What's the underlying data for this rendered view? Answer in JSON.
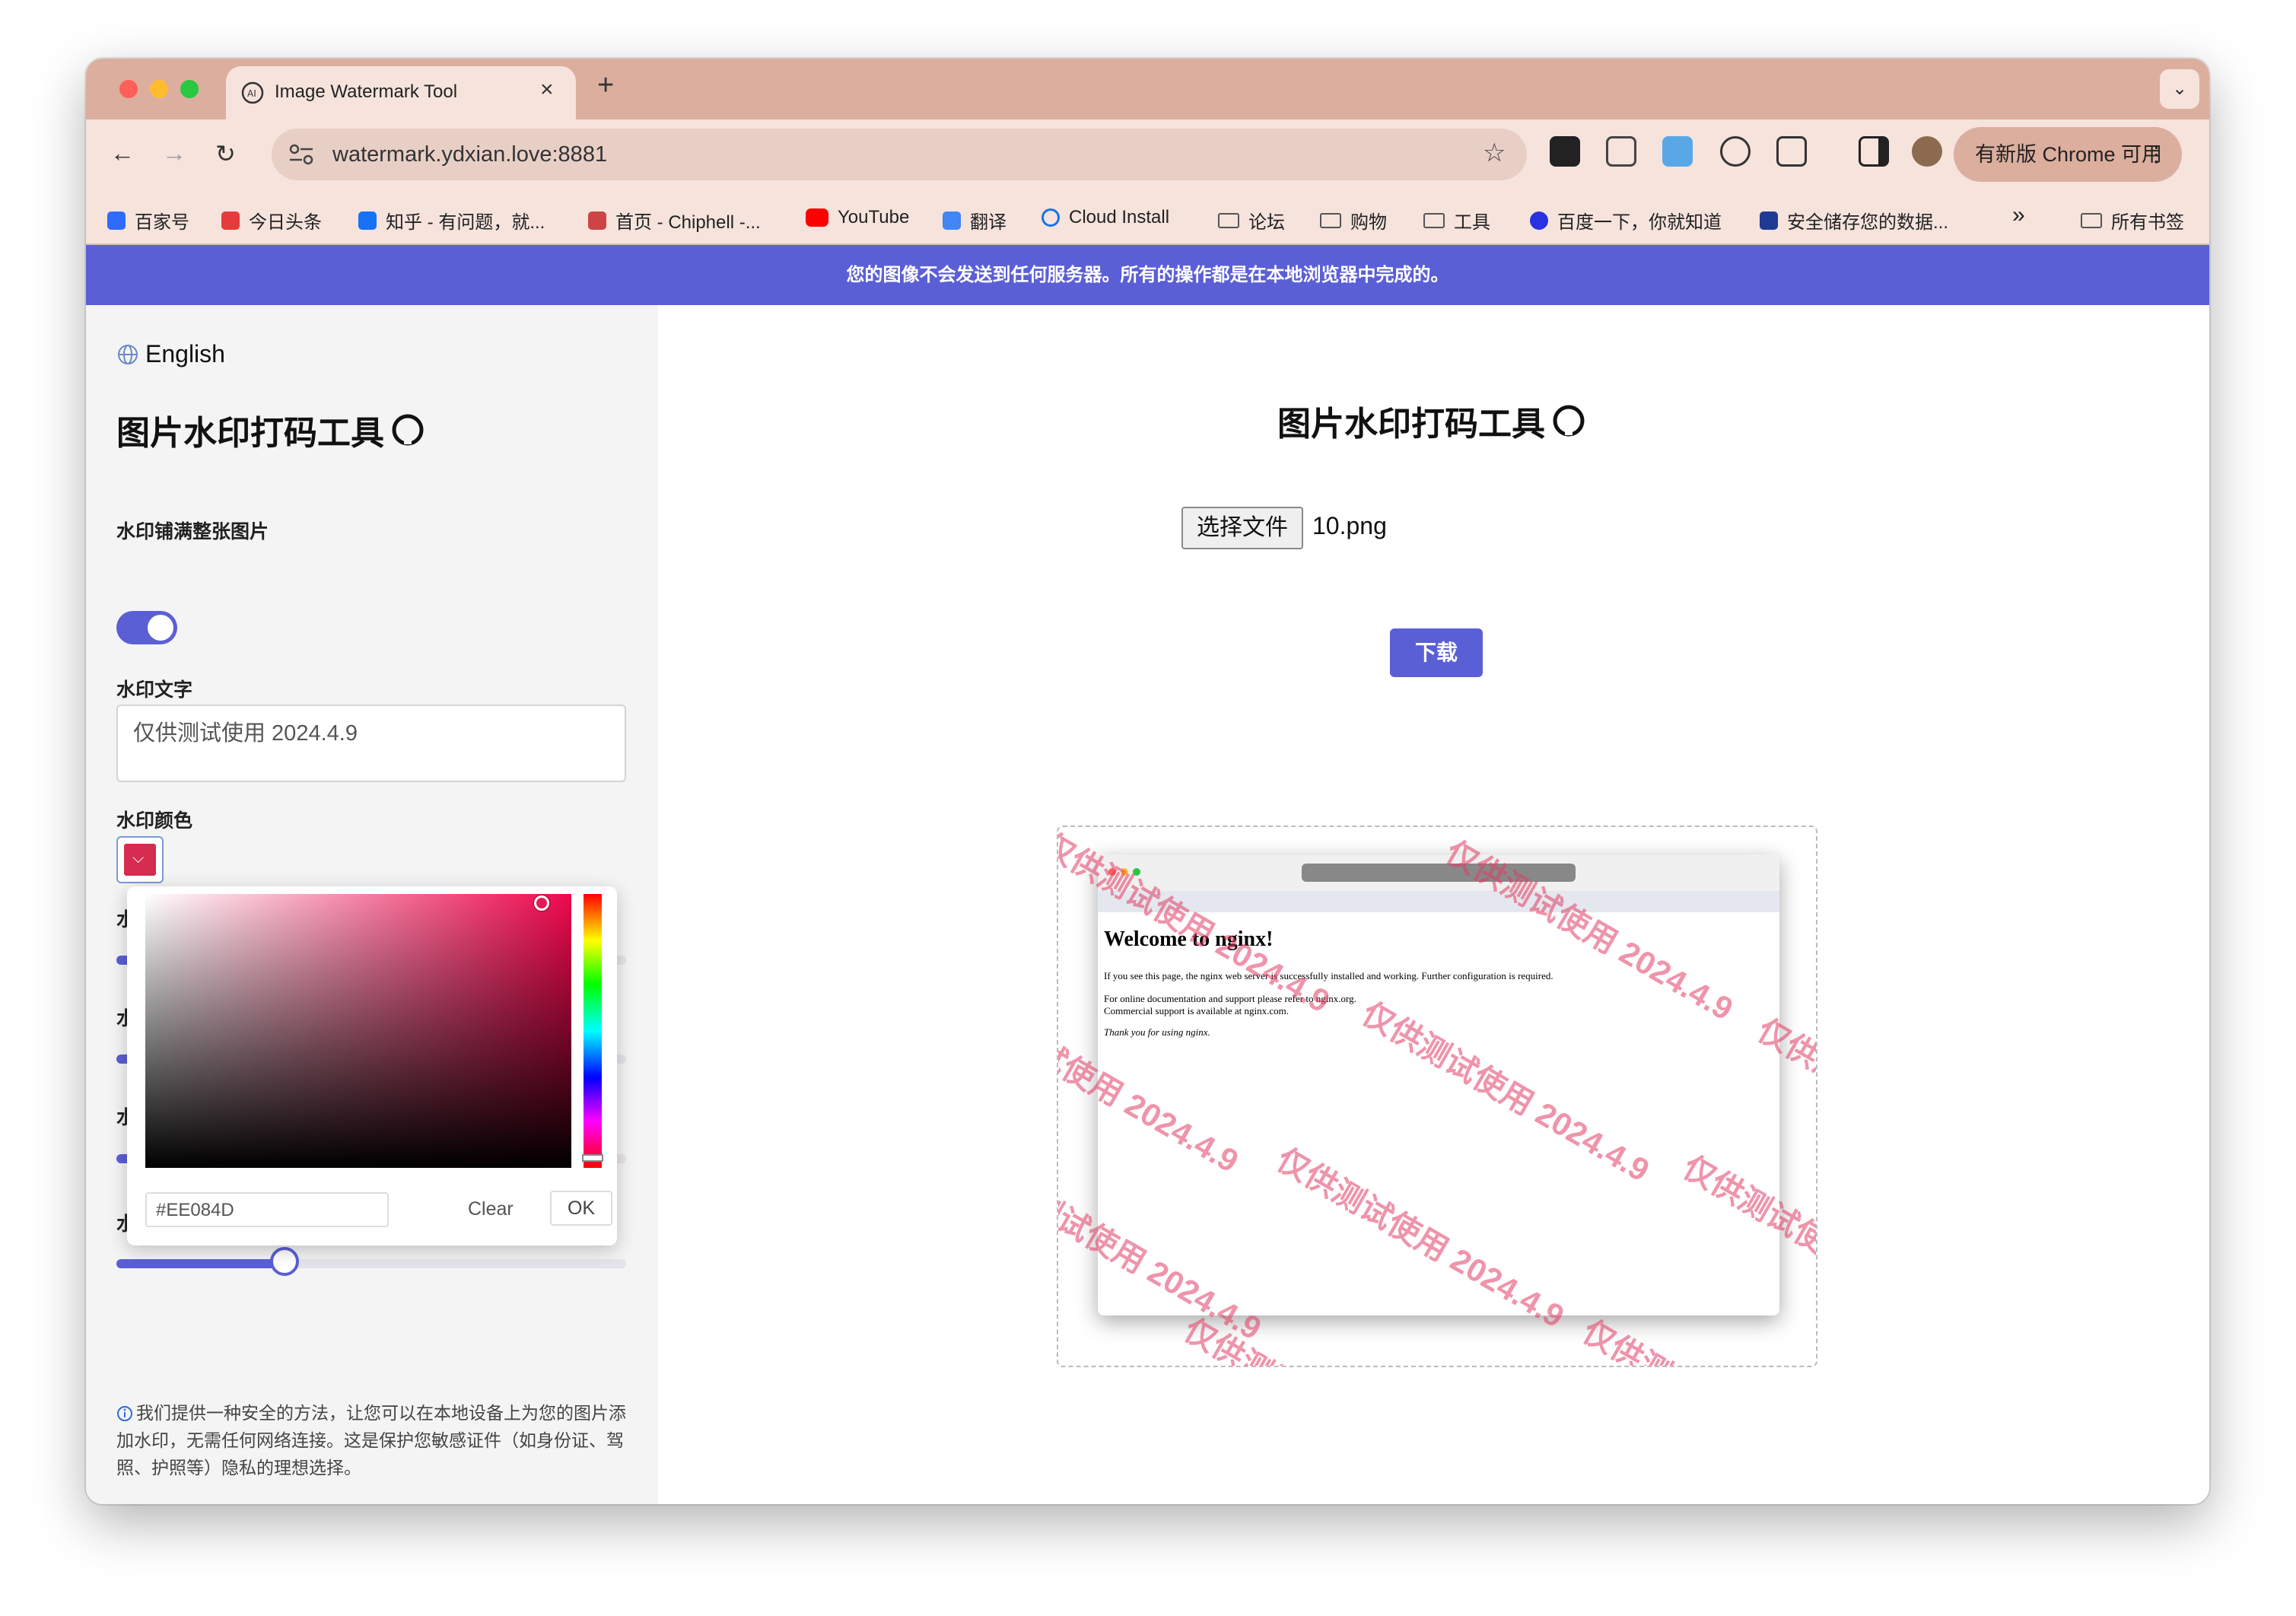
{
  "browser": {
    "tab_title": "Image Watermark Tool",
    "tab_close": "×",
    "new_tab": "+",
    "url": "watermark.ydxian.love:8881",
    "update_button": "有新版 Chrome 可用",
    "bookmarks": [
      {
        "label": "百家号",
        "icon": "baijiahao-icon",
        "color": "#2f6bff"
      },
      {
        "label": "今日头条",
        "icon": "toutiao-icon",
        "color": "#e63b3b"
      },
      {
        "label": "知乎 - 有问题，就...",
        "icon": "zhihu-icon",
        "color": "#1772f6"
      },
      {
        "label": "首页 - Chiphell -...",
        "icon": "chiphell-icon",
        "color": "#c44"
      },
      {
        "label": "YouTube",
        "icon": "youtube-icon",
        "color": "#ff0000"
      },
      {
        "label": "翻译",
        "icon": "translate-icon",
        "color": "#4285f4"
      },
      {
        "label": "Cloud Install",
        "icon": "cloud-icon",
        "color": "#1a73e8"
      },
      {
        "label": "论坛",
        "icon": "folder-icon"
      },
      {
        "label": "购物",
        "icon": "folder-icon"
      },
      {
        "label": "工具",
        "icon": "folder-icon"
      },
      {
        "label": "百度一下，你就知道",
        "icon": "baidu-icon",
        "color": "#2932e1"
      },
      {
        "label": "安全储存您的数据...",
        "icon": "storage-icon",
        "color": "#1f3a93"
      }
    ],
    "more_bookmarks": "»",
    "all_bookmarks": "所有书签"
  },
  "banner": "您的图像不会发送到任何服务器。所有的操作都是在本地浏览器中完成的。",
  "sidebar": {
    "language": "English",
    "title": "图片水印打码工具",
    "tile_label": "水印铺满整张图片",
    "text_label": "水印文字",
    "text_value": "仅供测试使用 2024.4.9",
    "color_label": "水印颜色",
    "color_value": "#d52c4f",
    "cut_label_char": "水",
    "slider_opacity_fraction": 0.33,
    "picker": {
      "hex": "#EE084D",
      "clear": "Clear",
      "ok": "OK"
    },
    "note": "我们提供一种安全的方法，让您可以在本地设备上为您的图片添加水印，无需任何网络连接。这是保护您敏感证件（如身份证、驾照、护照等）隐私的理想选择。"
  },
  "main": {
    "title": "图片水印打码工具",
    "choose_file": "选择文件",
    "file_name": "10.png",
    "download": "下载",
    "preview": {
      "watermark_text": "仅供测试使用 2024.4.9",
      "nginx_heading": "Welcome to nginx!",
      "nginx_p1": "If you see this page, the nginx web server is successfully installed and working. Further configuration is required.",
      "nginx_p2": "For online documentation and support please refer to nginx.org.",
      "nginx_p3": "Commercial support is available at nginx.com.",
      "nginx_p4": "Thank you for using nginx."
    }
  },
  "colors": {
    "accent": "#5b5fd6",
    "tabstrip": "#dcae9e",
    "toolbar": "#f5e3dc"
  }
}
